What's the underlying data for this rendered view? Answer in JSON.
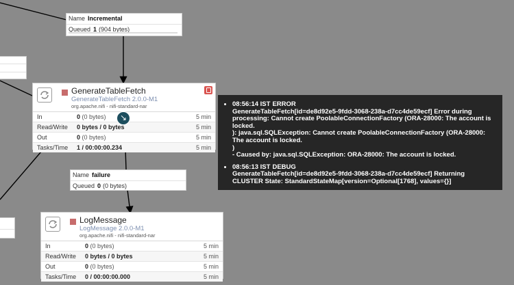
{
  "connections": {
    "incremental": {
      "name_label": "Name",
      "name": "Incremental",
      "queued_label": "Queued",
      "queued_count": "1",
      "queued_size": "(904 bytes)"
    },
    "failure": {
      "name_label": "Name",
      "name": "failure",
      "queued_label": "Queued",
      "queued_count": "0",
      "queued_size": "(0 bytes)"
    }
  },
  "processors": {
    "generate_table_fetch": {
      "name": "GenerateTableFetch",
      "type": "GenerateTableFetch 2.0.0-M1",
      "bundle": "org.apache.nifi - nifi-standard-nar",
      "stats": [
        {
          "label": "In",
          "value": "0",
          "detail": "(0 bytes)",
          "time": "5 min"
        },
        {
          "label": "Read/Write",
          "value": "0 bytes / 0 bytes",
          "detail": "",
          "time": "5 min"
        },
        {
          "label": "Out",
          "value": "0",
          "detail": "(0 bytes)",
          "time": "5 min"
        },
        {
          "label": "Tasks/Time",
          "value": "1 / 00:00:00.234",
          "detail": "",
          "time": "5 min"
        }
      ],
      "status": "stopped",
      "has_bulletin": true
    },
    "log_message": {
      "name": "LogMessage",
      "type": "LogMessage 2.0.0-M1",
      "bundle": "org.apache.nifi - nifi-standard-nar",
      "stats": [
        {
          "label": "In",
          "value": "0",
          "detail": "(0 bytes)",
          "time": "5 min"
        },
        {
          "label": "Read/Write",
          "value": "0 bytes / 0 bytes",
          "detail": "",
          "time": "5 min"
        },
        {
          "label": "Out",
          "value": "0",
          "detail": "(0 bytes)",
          "time": "5 min"
        },
        {
          "label": "Tasks/Time",
          "value": "0 / 00:00:00.000",
          "detail": "",
          "time": "5 min"
        }
      ],
      "status": "stopped"
    }
  },
  "bulletins": [
    {
      "time": "08:56:14 IST",
      "level": "ERROR",
      "message": "GenerateTableFetch[id=de8d92e5-9fdd-3068-238a-d7cc4de59ecf] Error during processing: Cannot create PoolableConnectionFactory (ORA-28000: The account is locked.\n): java.sql.SQLException: Cannot create PoolableConnectionFactory (ORA-28000: The account is locked.\n)\n- Caused by: java.sql.SQLException: ORA-28000: The account is locked."
    },
    {
      "time": "08:56:13 IST",
      "level": "DEBUG",
      "message": "GenerateTableFetch[id=de8d92e5-9fdd-3068-238a-d7cc4de59ecf] Returning CLUSTER State: StandardStateMap[version=Optional[1768], values={}]"
    }
  ],
  "colors": {
    "canvas": "#8a8a8a",
    "stopped_status": "#c76c6c",
    "bulletin": "#d9534f",
    "tooltip_bg": "#262626",
    "type_text": "#7d8fb0"
  },
  "icons": {
    "processor_logo": "processor-refresh-icon",
    "bulletin": "bulletin-icon",
    "stopped": "stop-square-icon",
    "cursor": "pointer-cursor-icon"
  }
}
